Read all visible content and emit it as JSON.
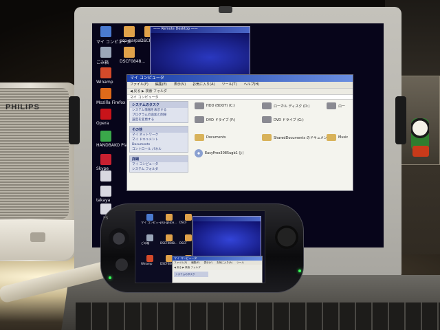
{
  "speaker": {
    "brand": "PHILIPS"
  },
  "laptop": {
    "desktop_icons": [
      {
        "label": "マイ コンピュータ",
        "icon": "computer-icon",
        "color": "#4a7ad0"
      },
      {
        "label": "ごみ箱",
        "icon": "recycle-bin-icon",
        "color": "#9aa6b8"
      },
      {
        "label": "Winamp",
        "icon": "winamp-icon",
        "color": "#d44a2a"
      },
      {
        "label": "Mozilla Firefox",
        "icon": "firefox-icon",
        "color": "#e06a1a"
      },
      {
        "label": "Opera",
        "icon": "opera-icon",
        "color": "#c8141a"
      },
      {
        "label": "HANDBAKO Player",
        "icon": "player-icon",
        "color": "#3aa84a"
      },
      {
        "label": "Skype",
        "icon": "skype-icon",
        "color": "#c82030"
      },
      {
        "label": "",
        "icon": "shortcut-icon",
        "color": "#d8d8e0"
      },
      {
        "label": "takaya",
        "icon": "file-icon",
        "color": "#d8d8e0"
      },
      {
        "label": "",
        "icon": "file-icon",
        "color": "#d8d8e0"
      },
      {
        "label": "psp-garpa...",
        "icon": "shortcut-icon",
        "color": "#e0a24a"
      },
      {
        "label": "DSCF8845...",
        "icon": "image-icon",
        "color": "#e0a24a"
      },
      {
        "label": "DSCF0848...",
        "icon": "image-icon",
        "color": "#e0a24a"
      }
    ],
    "remote_window_title": "—— Remote Desktop ——",
    "explorer": {
      "title": "マイ コンピュータ",
      "menu": [
        "ファイル(F)",
        "編集(E)",
        "表示(V)",
        "お気に入り(A)",
        "ツール(T)",
        "ヘルプ(H)"
      ],
      "toolbar": "◀ 戻る ▶  検索  フォルダ",
      "address": "マイ コンピュータ",
      "panels": [
        {
          "title": "システムのタスク",
          "items": [
            "システム情報を表示する",
            "プログラムの追加と削除",
            "設定を変更する"
          ]
        },
        {
          "title": "その他",
          "items": [
            "マイ ネットワーク",
            "マイ ドキュメント",
            "Documents",
            "コントロール パネル"
          ]
        },
        {
          "title": "詳細",
          "items": [
            "マイ コンピュータ",
            "システム フォルダ"
          ]
        }
      ],
      "drives": [
        {
          "label": "HDD (BOOT) (C:)",
          "type": "disk"
        },
        {
          "label": "ローカル ディスク (D:)",
          "type": "disk"
        },
        {
          "label": "ロー",
          "type": "disk"
        },
        {
          "label": "DVD ドライブ (F:)",
          "type": "disk"
        },
        {
          "label": "DVD ドライブ (G:)",
          "type": "disk"
        },
        {
          "label": "Documents",
          "type": "folder"
        },
        {
          "label": "SharedDocuments のドキュメント",
          "type": "folder"
        },
        {
          "label": "Music",
          "type": "folder"
        },
        {
          "label": "EasyFree3085ugb1 (J:)",
          "type": "cd"
        }
      ]
    }
  },
  "psp": {
    "logo": "PS",
    "desktop_icons": [
      {
        "label": "マイ コンピュータ",
        "color": "#4a7ad0"
      },
      {
        "label": "psp-garpa...",
        "color": "#e0a24a"
      },
      {
        "label": "DSCF",
        "color": "#e0a24a"
      },
      {
        "label": "ごみ箱",
        "color": "#9aa6b8"
      },
      {
        "label": "DSCF0848...",
        "color": "#e0a24a"
      },
      {
        "label": "DSCF",
        "color": "#e0a24a"
      },
      {
        "label": "Winamp",
        "color": "#d44a2a"
      },
      {
        "label": "DSCF0849...",
        "color": "#e0a24a"
      },
      {
        "label": "DSCF",
        "color": "#e0a24a"
      }
    ],
    "explorer": {
      "title": "マイ コンピュータ",
      "menu": [
        "ファイル(F)",
        "編集(E)",
        "表示(V)",
        "お気に入り(A)",
        "ツール"
      ],
      "toolbar": "◀ 戻る ▶  検索  フォルダ",
      "side": "システムのタスク"
    }
  }
}
